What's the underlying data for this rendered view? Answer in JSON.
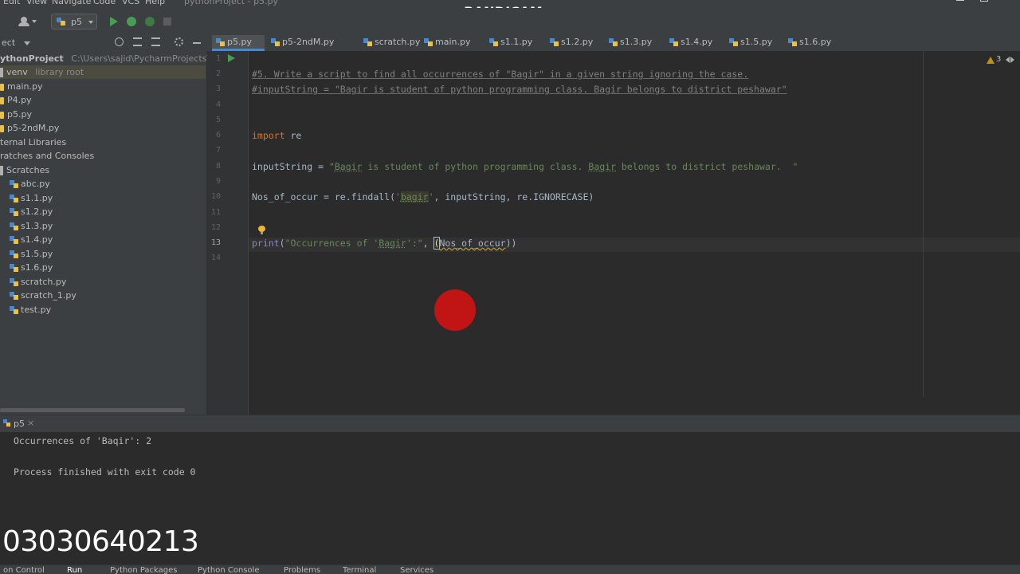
{
  "menubar": {
    "items": [
      "Edit",
      "View",
      "Navigate",
      "Code",
      "VCS",
      "Help"
    ],
    "window_title": "pythonProject - p5.py"
  },
  "watermark": "www.BANDICAM.com",
  "toolbar": {
    "run_config": "p5"
  },
  "project": {
    "header_label": "ect",
    "root_name": "ythonProject",
    "root_path": "C:\\Users\\sajid\\PycharmProjects\\pythonP",
    "venv_label": "venv",
    "venv_note": "library root",
    "files": [
      "main.py",
      "P4.py",
      "p5.py",
      "p5-2ndM.py"
    ],
    "external_libraries": "ternal Libraries",
    "scratches_and_consoles": "ratches and Consoles",
    "scratches_folder": "Scratches",
    "scratch_files": [
      "abc.py",
      "s1.1.py",
      "s1.2.py",
      "s1.3.py",
      "s1.4.py",
      "s1.5.py",
      "s1.6.py",
      "scratch.py",
      "scratch_1.py",
      "test.py"
    ]
  },
  "tabs": [
    "p5.py",
    "p5-2ndM.py",
    "scratch.py",
    "main.py",
    "s1.1.py",
    "s1.2.py",
    "s1.3.py",
    "s1.4.py",
    "s1.5.py",
    "s1.6.py"
  ],
  "active_tab": "p5.py",
  "editor": {
    "inspection_count": "3",
    "line_numbers": [
      "1",
      "2",
      "3",
      "4",
      "5",
      "6",
      "7",
      "8",
      "9",
      "10",
      "11",
      "12",
      "13",
      "14"
    ],
    "current_line": "13",
    "code": {
      "l2": "#5. Write a script to find all occurrences of \"Bagir\" in a given string ignoring the case.",
      "l3": "#inputString = \"Bagir is student of python programming class. Bagir belongs to district peshawar\"",
      "l6_kw": "import",
      "l6_rest": " re",
      "l8_a": "inputString = ",
      "l8_q": "\"",
      "l8_w1": "Bagir",
      "l8_b": " is student of python programming class. ",
      "l8_w2": "Bagir",
      "l8_c": " belongs to district peshawar.  \"",
      "l10_a": "Nos_of_occur = re.findall(",
      "l10_q1": "'",
      "l10_w": "bagir",
      "l10_q2": "'",
      "l10_b": ", inputString, re.IGNORECASE)",
      "l13_fn": "print",
      "l13_a": "(",
      "l13_s1": "\"Occurrences of '",
      "l13_w": "Bagir",
      "l13_s2": "':\"",
      "l13_b": ", ",
      "l13_p": "(",
      "l13_v": "Nos_of_occur",
      "l13_c": "))"
    }
  },
  "run": {
    "tab_label": "p5",
    "output": [
      "Occurrences of 'Baqir': 2",
      "",
      "Process finished with exit code 0"
    ]
  },
  "overlay_phone": "03030640213",
  "bottom_tabs": [
    "on Control",
    "Run",
    "Python Packages",
    "Python Console",
    "Problems",
    "Terminal",
    "Services"
  ]
}
